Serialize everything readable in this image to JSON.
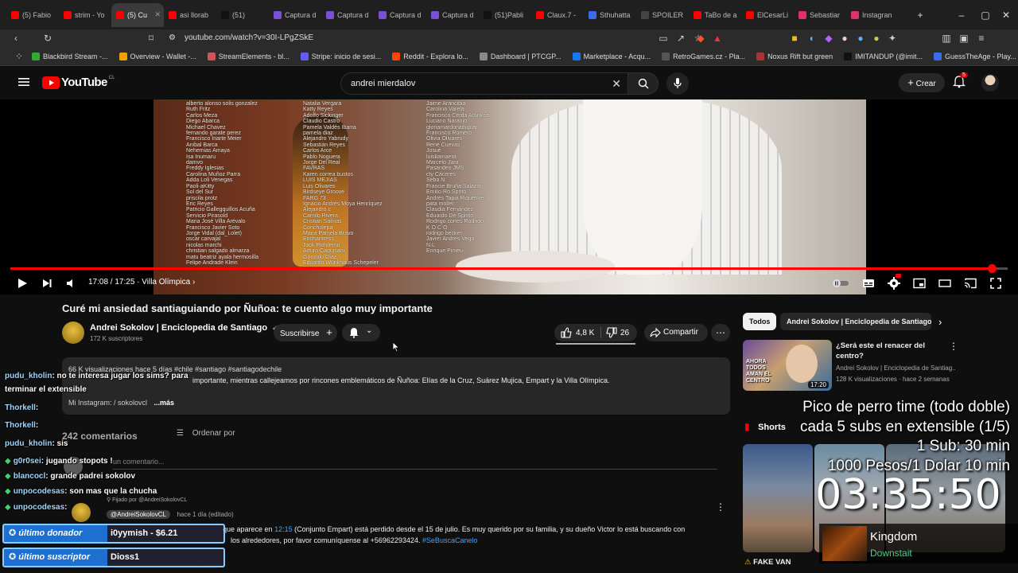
{
  "browser": {
    "tabs": [
      {
        "label": "(5) Fabio",
        "color": "#ff0000"
      },
      {
        "label": "strim - Yo",
        "color": "#ff0000"
      },
      {
        "label": "(5) Cu",
        "color": "#ff0000",
        "active": true
      },
      {
        "label": "asi llorab",
        "color": "#ff0000"
      },
      {
        "label": "(51)",
        "color": "#111111"
      },
      {
        "label": "Captura d",
        "color": "#7b4fd6"
      },
      {
        "label": "Captura d",
        "color": "#7b4fd6"
      },
      {
        "label": "Captura d",
        "color": "#7b4fd6"
      },
      {
        "label": "Captura d",
        "color": "#7b4fd6"
      },
      {
        "label": "(51)Pabli",
        "color": "#111111"
      },
      {
        "label": "Claux.7 -",
        "color": "#ff0000"
      },
      {
        "label": "Sthuhatta",
        "color": "#3a6cf0"
      },
      {
        "label": "SPOILER",
        "color": "#444444"
      },
      {
        "label": "TaBo de a",
        "color": "#ff0000"
      },
      {
        "label": "ElCesarLi",
        "color": "#ff0000"
      },
      {
        "label": "Sebastiar",
        "color": "#e1306c"
      },
      {
        "label": "Instagran",
        "color": "#e1306c"
      }
    ],
    "url": "youtube.com/watch?v=30I-LPgZSkE",
    "bookmarks": [
      {
        "label": "Blackbird Stream -...",
        "color": "#33aa33"
      },
      {
        "label": "Overview - Wallet -...",
        "color": "#f0a000"
      },
      {
        "label": "StreamElements - bl...",
        "color": "#cc5555"
      },
      {
        "label": "Stripe: inicio de sesi...",
        "color": "#635bff"
      },
      {
        "label": "Reddit - Explora lo...",
        "color": "#ff4500"
      },
      {
        "label": "Dashboard | PTCGP...",
        "color": "#888888"
      },
      {
        "label": "Marketplace - Acqu...",
        "color": "#1877f2"
      },
      {
        "label": "RetroGames.cz - Pla...",
        "color": "#555555"
      },
      {
        "label": "Noxus Rift but green",
        "color": "#aa3333"
      },
      {
        "label": "IMITANDUP (@imit...",
        "color": "#111111"
      },
      {
        "label": "GuessTheAge - Play...",
        "color": "#3a6cf0"
      }
    ]
  },
  "youtube": {
    "logo": "YouTube",
    "country": "CL",
    "search_query": "andrei mierdalov",
    "create_label": "Crear",
    "notifications": "5"
  },
  "video": {
    "time": "17:08 / 17:25",
    "chapter": "Villa Olímpica",
    "progress": 0.984,
    "credits": [
      "alberto alonso solis gonzalez\nRuth Fritz\nCarlos Meza\nDiego Abarca\nMichael Chavez\nfernando garate perez\nFrancisco Iriarte Meier\nAnibal Barca\nNehemias Amaya\nIsa Inumaru\ndamvo\nFreddy Iglesias\nCarolina Muñoz Parra\nAdda Loli Venegas\nPaoli·aKitty\nSol del Sur\npriscila protz\nEric Reyes\nPatricio Gallegquillos Acuña\nServicio Pirasold\nMaria José Villa Arévalo\nFrancisco Javier Soto\nJorge Vidal (dal_Lolet)\noscar carvajal\nnicolas marchi\nchristian salgado almarza\nmatu beatriz ayala hermosilla\nFelipe Andrade Klein",
      "Natalia Vergara\nKatty Reyes\nAdolfo Sickinger\nClaudio Castro\nPamela Valdés Ibarra\npamela diaz\nAlejandro Yabrudy\nSebastián Reyes\nCarlos Arce\nPablo Noguera\nJorge Del Real\nFAVRAS\nKaren correa bustos\nLUIS MEJIAS\nLuis Olivares\nBirdseye Groove\nFARG 73\nIgnacio Andrés Moya Henríquez\nAlejandro c\nCamilo Rivera\nCristian Salinas\nConcholepa\nMaria Pamela Bravo\nEnchantress\nJack Pichilemu\nArturo Caquisani\nGonzalo Díaz\nEduardo Wünkhaus Schepeler",
      "Jaime Arancibia\nCarolina Varela\nFrancisco Cerda Aránkez\nLuciano Naranjo\ngloriamardonaduplap\nFrancisco Romero\nOlivia Olivares\nRené Cuevas\nJosué\nluiskamaera\nMarcelo Jara\nPasandeo JMS\ncty Cáceres\nSeba N\nFrancie Bruña Salazar\nEmilio Ro Sprito\nAndrés Tapia Riquelme\npata moller\nClaudia Fernández\nEduardo De Spirito\nRodrigo cortes Rodrigo\nK O C O\nrodrigo becker\nJavier Andrés Vega\nN.L\nEnrique Pimeu"
    ]
  },
  "watch": {
    "title": "Curé mi ansiedad santiaguiando por Ñuñoa: te cuento algo muy importante",
    "channel": "Andrei Sokolov | Enciclopedia de Santiago",
    "subscribers": "172 K suscriptores",
    "subscribe_label": "Suscribirse",
    "likes": "4,8 K",
    "dislikes": "26",
    "share_label": "Compartir",
    "description": {
      "stats": "66 K visualizaciones  hace 5 días  #chile #santiago #santiagodechile",
      "text": "importante, mientras callejeamos por rincones emblemáticos de Ñuñoa: Elías de la Cruz, Suárez Mujica, Empart y la Villa Olímpica.",
      "instagram": "Mi Instagram:  / sokolovcl",
      "more": "...más"
    },
    "comments_count": "242 comentarios",
    "sort_label": "Ordenar por",
    "add_comment_placeholder": "un comentario...",
    "pinned_by": "Fijado por @AndreiSokolovCL",
    "pinned_author": "@AndreiSokolovCL",
    "pinned_time": "hace 1 día (editado)",
    "pinned_text_1": "que aparece en ",
    "pinned_timestamp": "12:15",
    "pinned_text_2": " (Conjunto Empart) está perdido desde el 15 de julio. Es muy querido por su familia, y su dueño Victor lo está buscando con",
    "pinned_text_3": "los alrededores, por favor comuníquense al +56962293424. ",
    "pinned_hashtag": "#SeBuscaCanelo"
  },
  "chat": {
    "lines": [
      {
        "user": "",
        "text": "",
        "badge": false
      },
      {
        "user": "pudu_kholin",
        "text": ": no te interesa jugar los sims? para",
        "badge": false
      },
      {
        "user": "",
        "text": "terminar el extensible",
        "badge": false
      },
      {
        "user": "Thorkell",
        "text": ":",
        "badge": false
      },
      {
        "user": "Thorkell",
        "text": ":",
        "badge": false
      },
      {
        "user": "pudu_kholin",
        "text": ": sis",
        "badge": false
      },
      {
        "user": "g0r0sei",
        "text": ": jugando stopots !",
        "badge": true
      },
      {
        "user": "blancocl",
        "text": ": grande padrei sokolov",
        "badge": true
      },
      {
        "user": "unpocodesas",
        "text": ": son mas que la chucha",
        "badge": true
      },
      {
        "user": "unpocodesas",
        "text": ":",
        "badge": true
      }
    ],
    "last_donor_label": "último donador",
    "last_donor_value": "i0yymish - $6.21",
    "last_sub_label": "último suscriptor",
    "last_sub_value": "Dioss1"
  },
  "sidebar": {
    "chips": [
      "Todos",
      "Andrei Sokolov | Enciclopedia de Santiago"
    ],
    "rec": [
      {
        "title": "¿Será este el renacer del centro?",
        "channel": "Andrei Sokolov | Enciclopedia de Santiag...",
        "meta": "128 K visualizaciones · hace 2 semanas",
        "duration": "17:20",
        "thumb_text": "AHORA TODOS AMAN EL CENTRO"
      },
      {
        "title": "FAKE VAN",
        "meta": "",
        "duration": ""
      }
    ],
    "shorts_label": "Shorts"
  },
  "overlay": {
    "lines": [
      "Pico de perro time (todo doble)",
      "cada 5 subs en extensible (1/5)",
      "1 Sub: 30 min",
      "1000 Pesos/1 Dolar 10 min"
    ],
    "timer": "03:35:50",
    "music_title": "Kingdom",
    "music_artist": "Downstait"
  },
  "colors": {
    "yt_red": "#ff0000",
    "chat_user": "#9fd8ff",
    "badge_green": "#3fd070",
    "music_green": "#4fd08a"
  }
}
